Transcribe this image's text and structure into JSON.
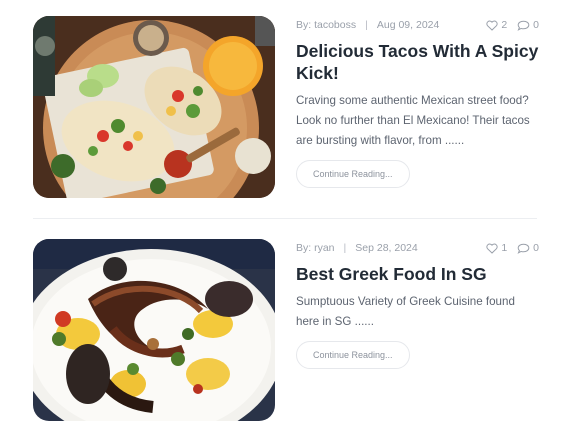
{
  "posts": [
    {
      "author": "By: tacoboss",
      "date": "Aug 09, 2024",
      "likes": "2",
      "comments": "0",
      "title": "Delicious Tacos With A Spicy Kick!",
      "excerpt": "Craving some authentic Mexican street food? Look no further than El Mexicano! Their tacos are bursting with flavor, from ......",
      "button": "Continue Reading..."
    },
    {
      "author": "By: ryan",
      "date": "Sep 28, 2024",
      "likes": "1",
      "comments": "0",
      "title": "Best Greek Food In SG",
      "excerpt": "Sumptuous Variety of Greek Cuisine found here in SG ......",
      "button": "Continue Reading..."
    }
  ],
  "colors": {
    "meta": "#9aa0aa",
    "title": "#222b36",
    "text": "#5d6470",
    "border": "#e6e8ec"
  },
  "icons": [
    "heart-icon",
    "comment-icon"
  ]
}
